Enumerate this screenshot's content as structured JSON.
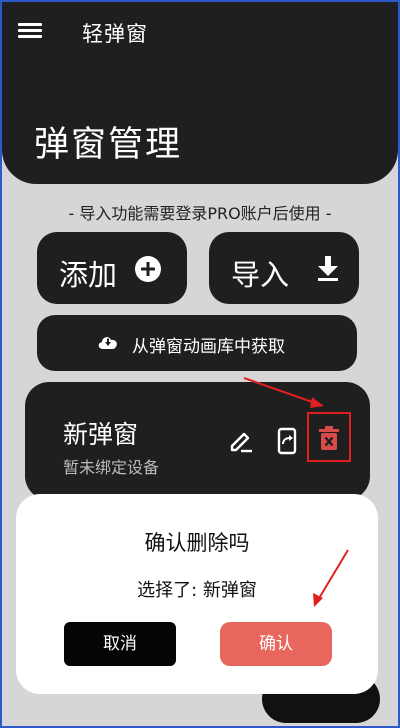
{
  "app_bar": {
    "title": "轻弹窗",
    "menu_icon": "menu-icon"
  },
  "hero": {
    "title": "弹窗管理"
  },
  "notice": "- 导入功能需要登录PRO账户后使用 -",
  "actions": {
    "add_label": "添加",
    "add_icon": "plus-circle-icon",
    "import_label": "导入",
    "import_icon": "download-icon",
    "library_label": "从弹窗动画库中获取",
    "library_icon": "cloud-download-icon"
  },
  "popup_item": {
    "name": "新弹窗",
    "status": "暂未绑定设备",
    "icons": [
      "edit-icon",
      "share-icon",
      "delete-icon"
    ]
  },
  "dialog": {
    "title": "确认删除吗",
    "message": "选择了: 新弹窗",
    "cancel_label": "取消",
    "confirm_label": "确认"
  },
  "colors": {
    "dark_surface": "#1f1f1f",
    "background": "#d6d6d6",
    "confirm": "#e9665f",
    "highlight": "#e02020",
    "delete_icon": "#d94a4a"
  }
}
